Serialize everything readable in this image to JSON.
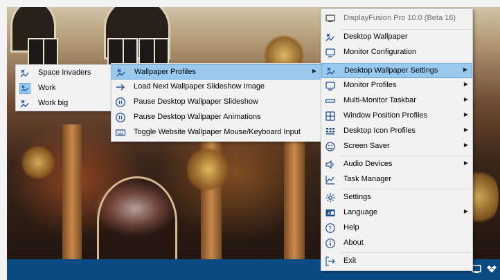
{
  "main_menu": {
    "header": "DisplayFusion Pro 10.0 (Beta 16)",
    "items": [
      {
        "label": "Desktop Wallpaper",
        "icon": "wallpaper-icon",
        "submenu": false
      },
      {
        "label": "Monitor Configuration",
        "icon": "monitor-icon",
        "submenu": false
      },
      {
        "label": "Desktop Wallpaper Settings",
        "icon": "wallpaper-icon",
        "submenu": true,
        "highlighted": true
      },
      {
        "label": "Monitor Profiles",
        "icon": "monitor-icon",
        "submenu": true
      },
      {
        "label": "Multi-Monitor Taskbar",
        "icon": "taskbar-icon",
        "submenu": true
      },
      {
        "label": "Window Position Profiles",
        "icon": "window-grid-icon",
        "submenu": true
      },
      {
        "label": "Desktop Icon Profiles",
        "icon": "desktop-icons-icon",
        "submenu": true
      },
      {
        "label": "Screen Saver",
        "icon": "screen-saver-icon",
        "submenu": true
      },
      {
        "label": "Audio Devices",
        "icon": "speaker-icon",
        "submenu": true
      },
      {
        "label": "Task Manager",
        "icon": "task-manager-icon",
        "submenu": false
      },
      {
        "label": "Settings",
        "icon": "gear-icon",
        "submenu": false
      },
      {
        "label": "Language",
        "icon": "language-icon",
        "submenu": true
      },
      {
        "label": "Help",
        "icon": "help-icon",
        "submenu": false
      },
      {
        "label": "About",
        "icon": "info-icon",
        "submenu": false
      },
      {
        "label": "Exit",
        "icon": "exit-icon",
        "submenu": false
      }
    ]
  },
  "wallpaper_settings_menu": {
    "items": [
      {
        "label": "Wallpaper Profiles",
        "icon": "wallpaper-icon",
        "submenu": true,
        "highlighted": true
      },
      {
        "label": "Load Next Wallpaper Slideshow Image",
        "icon": "arrow-right-icon"
      },
      {
        "label": "Pause Desktop Wallpaper Slideshow",
        "icon": "pause-icon"
      },
      {
        "label": "Pause Desktop Wallpaper Animations",
        "icon": "pause-icon"
      },
      {
        "label": "Toggle Website Wallpaper Mouse/Keyboard Input",
        "icon": "keyboard-icon"
      }
    ]
  },
  "wallpaper_profiles_menu": {
    "items": [
      {
        "label": "Space Invaders",
        "checked": false
      },
      {
        "label": "Work",
        "checked": true
      },
      {
        "label": "Work big",
        "checked": false
      }
    ]
  },
  "colors": {
    "highlight": "#99c9ef",
    "highlight_border": "#65a6db",
    "menu_bg": "#f2f2f2",
    "taskbar": "#0a4b83",
    "icon_blue": "#1f4f8f"
  }
}
